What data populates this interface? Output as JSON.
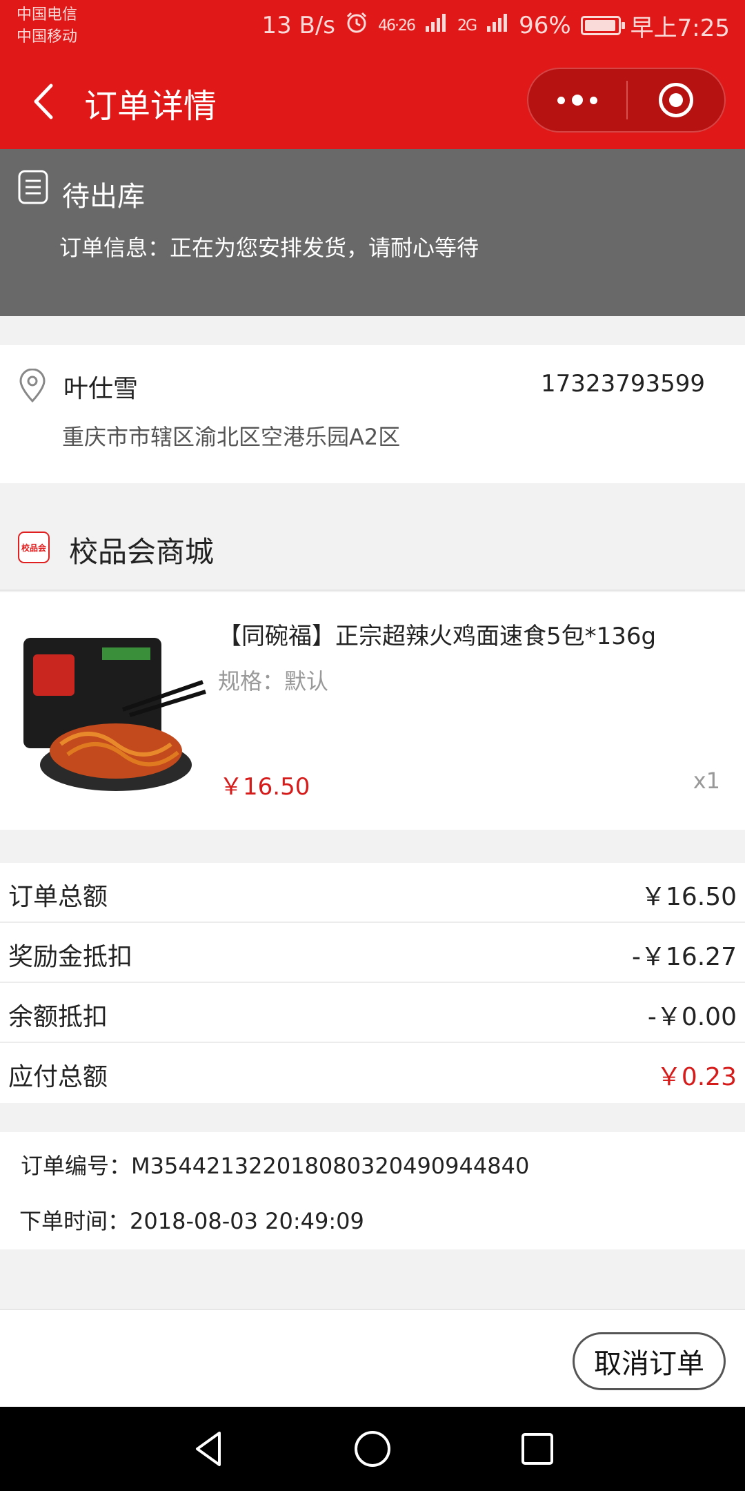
{
  "status_bar": {
    "carrier_1": "中国电信",
    "carrier_2": "中国移动",
    "net_speed": "13 B/s",
    "signal_1": "46·26",
    "signal_2": "2G",
    "battery": "96%",
    "battery_level": 0.96,
    "time": "早上7:25"
  },
  "nav": {
    "title": "订单详情",
    "back_icon": "chevron-left-icon",
    "more_icon": "more-dots-icon",
    "close_icon": "target-circle-icon"
  },
  "banner": {
    "status": "待出库",
    "info": "订单信息：正在为您安排发货，请耐心等待"
  },
  "address": {
    "name": "叶仕雪",
    "phone": "17323793599",
    "detail": "重庆市市辖区渝北区空港乐园A2区"
  },
  "shop": {
    "logo_text": "校品会",
    "name": "校品会商城"
  },
  "product": {
    "name": "【同碗福】正宗超辣火鸡面速食5包*136g",
    "spec": "规格：默认",
    "price": "￥16.50",
    "qty": "x1"
  },
  "summary": [
    {
      "label": "订单总额",
      "value": "￥16.50"
    },
    {
      "label": "奖励金抵扣",
      "value": "-￥16.27"
    },
    {
      "label": "余额抵扣",
      "value": "-￥0.00"
    },
    {
      "label": "应付总额",
      "value": "￥0.23"
    }
  ],
  "order": {
    "number": "订单编号：M35442132201808032049094484​0",
    "time": "下单时间：2018-08-03 20:49:09"
  },
  "actions": {
    "cancel_label": "取消订单"
  },
  "colors": {
    "brand_red": "#e01818",
    "price_red": "#d61b1b",
    "banner_gray": "#696969"
  }
}
